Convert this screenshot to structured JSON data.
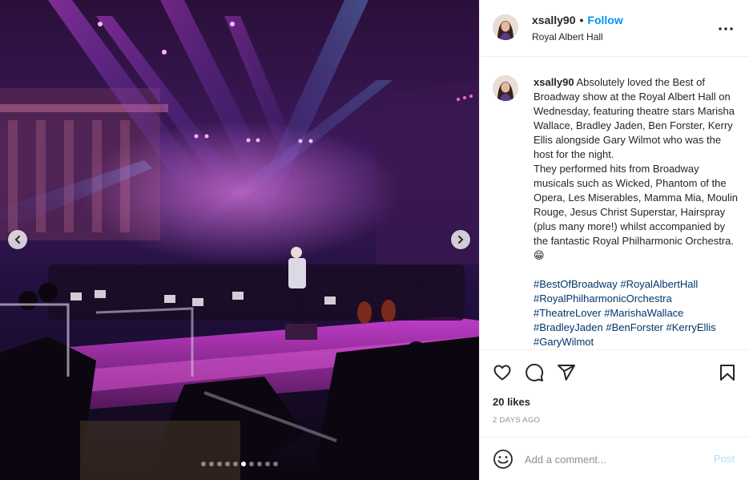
{
  "post": {
    "username": "xsally90",
    "separator": "•",
    "follow_label": "Follow",
    "location": "Royal Albert Hall",
    "caption_text": "Absolutely loved the Best of Broadway show at the Royal Albert Hall on Wednesday, featuring theatre stars Marisha Wallace, Bradley Jaden, Ben Forster, Kerry Ellis alongside Gary Wilmot who was the host for the night.\nThey performed hits from Broadway musicals such as Wicked, Phantom of the Opera, Les Miserables, Mamma Mia, Moulin Rouge, Jesus Christ Superstar, Hairspray (plus many more!) whilst accompanied by the fantastic Royal Philharmonic Orchestra. 😁",
    "hashtags": [
      "#BestOfBroadway",
      "#RoyalAlbertHall",
      "#RoyalPhilharmonicOrchestra",
      "#TheatreLover",
      "#MarishaWallace",
      "#BradleyJaden",
      "#BenForster",
      "#KerryEllis",
      "#GaryWilmot"
    ],
    "likes": "20 likes",
    "timestamp": "2 DAYS AGO",
    "comment_placeholder": "Add a comment...",
    "post_label": "Post"
  },
  "carousel": {
    "dot_count": 10,
    "active_index": 5
  },
  "icons": {
    "like": "heart-icon",
    "comment": "comment-icon",
    "share": "paper-plane-icon",
    "save": "bookmark-icon",
    "more": "more-options-icon",
    "emoji": "emoji-icon",
    "prev": "chevron-left-icon",
    "next": "chevron-right-icon"
  },
  "colors": {
    "accent": "#0095f6",
    "hashtag": "#00376b",
    "muted": "#8e8e8e",
    "post_disabled": "#b2dffc"
  }
}
